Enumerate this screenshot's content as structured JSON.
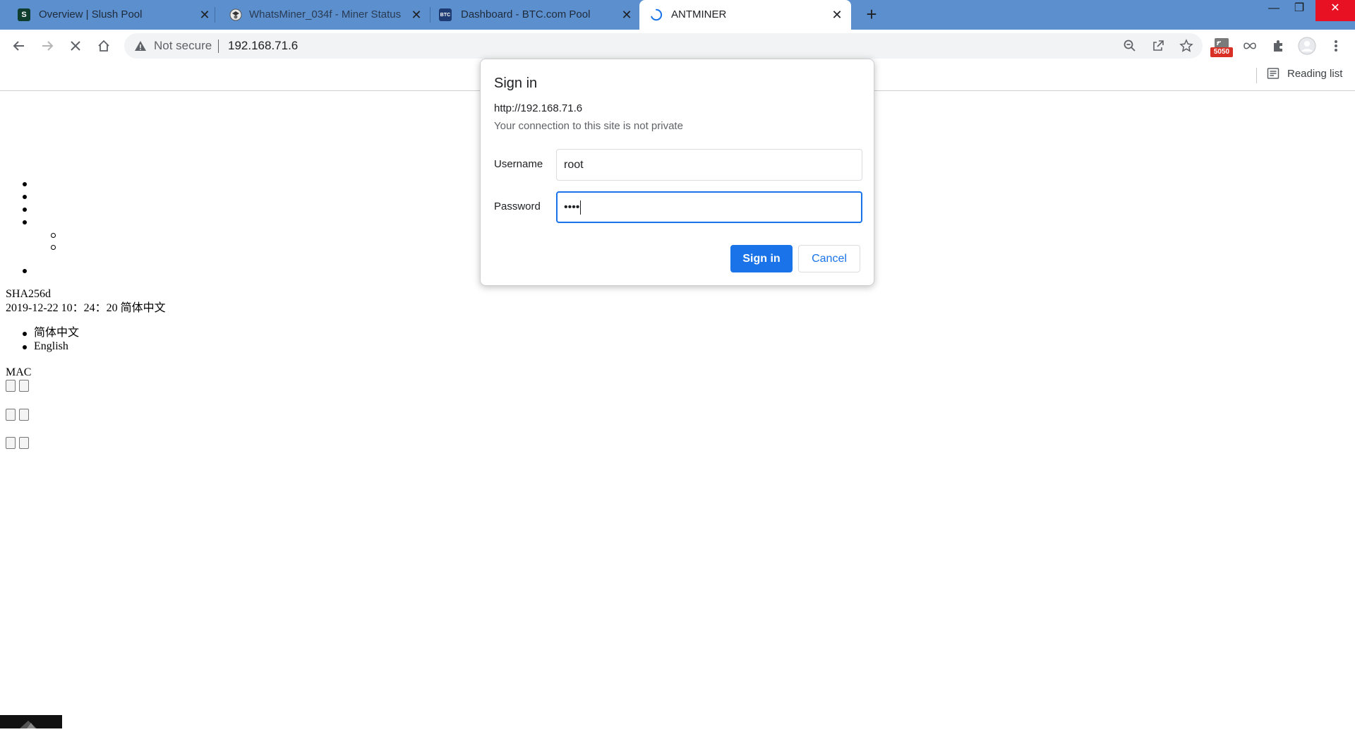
{
  "tabs": [
    {
      "title": "Overview | Slush Pool",
      "favicon": "S"
    },
    {
      "title": "WhatsMiner_034f - Miner Status",
      "favicon": ""
    },
    {
      "title": "Dashboard - BTC.com Pool",
      "favicon": "BTC"
    },
    {
      "title": "ANTMINER",
      "favicon": ""
    }
  ],
  "tab_close_glyph": "✕",
  "new_tab_glyph": "+",
  "window": {
    "minimize": "—",
    "restore": "❐",
    "close": "✕"
  },
  "omnibox": {
    "security_text": "Not secure",
    "url": "192.168.71.6"
  },
  "extension_badge": "5050",
  "bookmarks": {
    "reading_list": "Reading list"
  },
  "page": {
    "algo": "SHA256d",
    "datetime": "2019-12-22 10：24：20 简体中文",
    "languages": [
      "简体中文",
      "English"
    ],
    "mac_label": "MAC"
  },
  "dialog": {
    "title": "Sign in",
    "url": "http://192.168.71.6",
    "note": "Your connection to this site is not private",
    "username_label": "Username",
    "username_value": "root",
    "password_label": "Password",
    "password_value": "••••",
    "signin_label": "Sign in",
    "cancel_label": "Cancel"
  },
  "colors": {
    "tabstrip": "#5b8fce",
    "accent": "#1a73e8",
    "close_red": "#e81123"
  }
}
